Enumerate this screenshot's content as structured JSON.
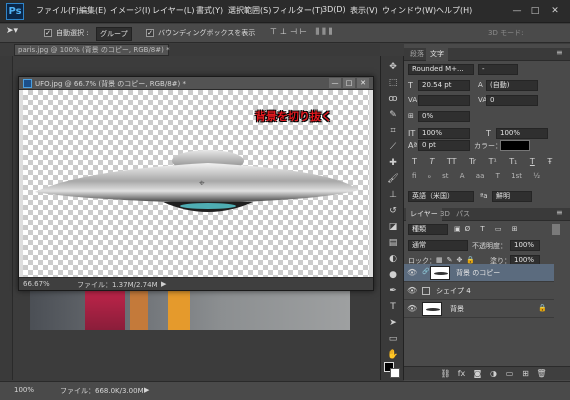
{
  "app": {
    "logo": "Ps"
  },
  "menu": [
    "ファイル(F)",
    "編集(E)",
    "イメージ(I)",
    "レイヤー(L)",
    "書式(Y)",
    "選択範囲(S)",
    "フィルター(T)",
    "3D(D)",
    "表示(V)",
    "ウィンドウ(W)",
    "ヘルプ(H)"
  ],
  "window_controls": {
    "minimize": "—",
    "maximize": "□",
    "close": "✕"
  },
  "options": {
    "auto_select_label": "自動選択 :",
    "auto_select_value": "グループ",
    "bbox_label": "バウンディングボックスを表示",
    "mode_3d_label": "3D モード:",
    "checked": "✓"
  },
  "back_tab": {
    "title": "paris.jpg @ 100% (背景 のコピー, RGB/8#) *"
  },
  "document": {
    "title": "UFO.jpg @ 66.7% (背景 のコピー, RGB/8#) *",
    "annotation": "背景を切り抜く",
    "zoom": "66.67%",
    "file_info": "ファイル：1.37M/2.74M",
    "arrow": "▶"
  },
  "status": {
    "zoom": "100%",
    "file_info": "ファイル：668.0K/3.00M"
  },
  "char_panel": {
    "tabs": [
      "段落",
      "文字"
    ],
    "font_family": "Rounded M+...",
    "font_style": "-",
    "font_size": "20.54 pt",
    "leading": "(自動)",
    "kerning": "",
    "tracking": "0",
    "tsume": "0%",
    "vertical_scale": "100%",
    "horizontal_scale": "100%",
    "baseline_shift": "0 pt",
    "color_label": "カラー：",
    "color": "#000000",
    "language": "英語（米国）",
    "antialias": "鮮明",
    "style_buttons": [
      "T",
      "T",
      "TT",
      "Tr",
      "T¹",
      "T₁",
      "T",
      "Ŧ"
    ],
    "extra_buttons": [
      "fi",
      "ℴ",
      "st",
      "A",
      "aa",
      "T",
      "1st",
      "½"
    ]
  },
  "layers_panel": {
    "tabs": [
      "レイヤー",
      "3D",
      "パス"
    ],
    "filter_label": "種類",
    "blend_mode": "通常",
    "opacity_label": "不透明度：",
    "opacity": "100%",
    "lock_label": "ロック：",
    "fill_label": "塗り：",
    "fill": "100%",
    "layers": [
      {
        "name": "背景 のコピー",
        "selected": true
      },
      {
        "name": "シェイプ 4",
        "selected": false
      },
      {
        "name": "背景",
        "selected": false,
        "locked": true
      }
    ],
    "link_icon": "🔗",
    "fx_label": "fx"
  }
}
